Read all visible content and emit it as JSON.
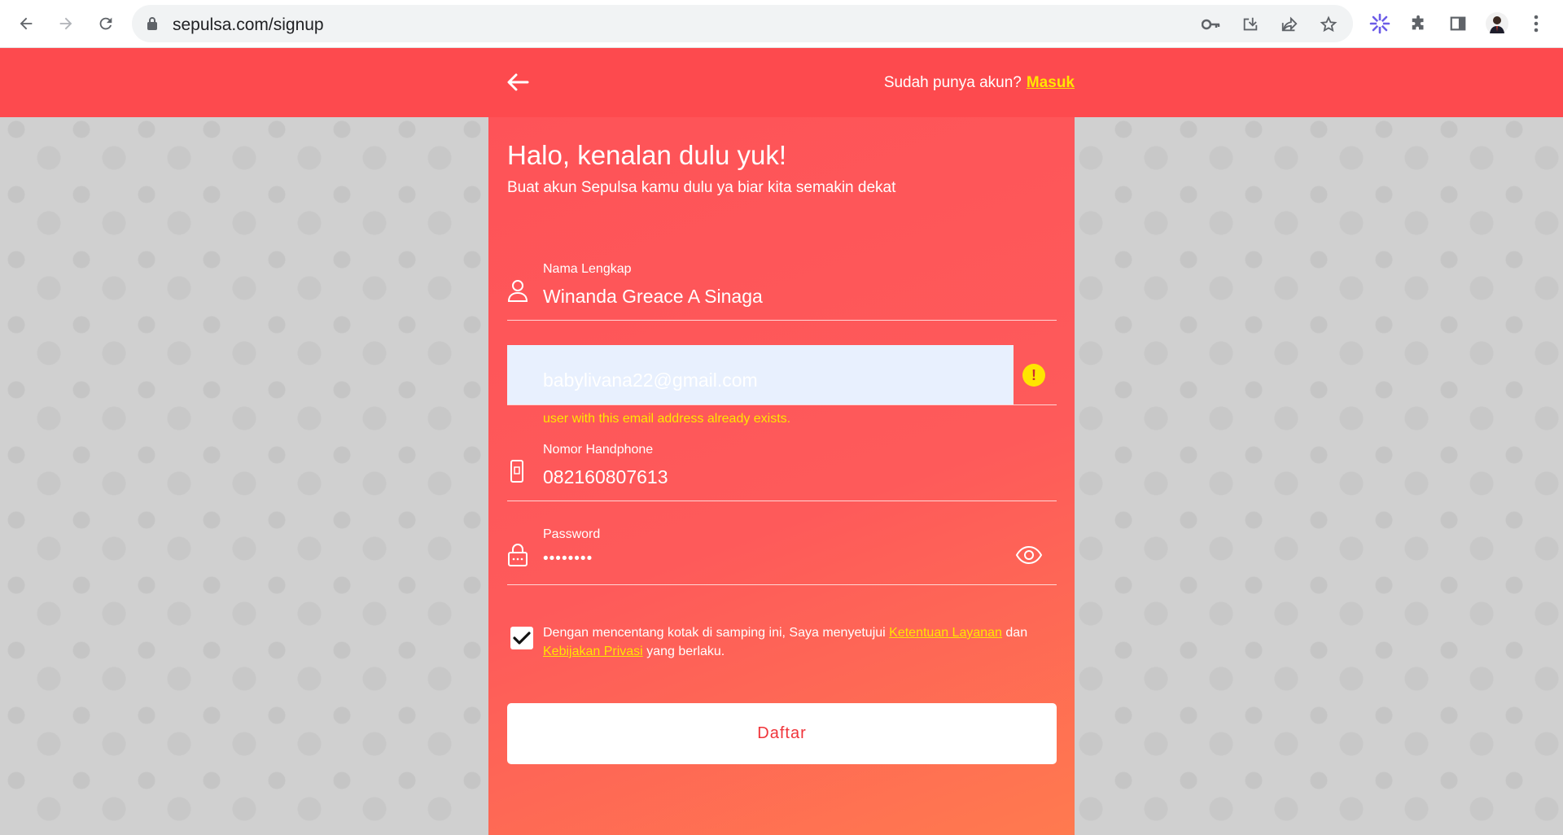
{
  "browser": {
    "url": "sepulsa.com/signup",
    "icons": [
      "back-icon",
      "forward-icon",
      "reload-icon",
      "lock-icon",
      "key-icon",
      "install-icon",
      "share-icon",
      "star-icon",
      "extension-flower-icon",
      "puzzle-icon",
      "sidepanel-icon",
      "profile-avatar",
      "menu-dots-icon"
    ]
  },
  "header": {
    "have_account_text": "Sudah punya akun?",
    "login_link": "Masuk"
  },
  "form": {
    "title": "Halo, kenalan dulu yuk!",
    "subtitle": "Buat akun Sepulsa kamu dulu ya biar kita semakin dekat",
    "name": {
      "label": "Nama Lengkap",
      "value": "Winanda Greace A Sinaga"
    },
    "email": {
      "value": "babylivana22@gmail.com",
      "error": "user with this email address already exists."
    },
    "phone": {
      "label": "Nomor Handphone",
      "value": "082160807613"
    },
    "password": {
      "label": "Password",
      "value": "••••••••"
    },
    "terms": {
      "prefix": "Dengan mencentang kotak di samping ini, Saya menyetujui",
      "tos_link": "Ketentuan Layanan",
      "and": "dan",
      "privacy_link": "Kebijakan Privasi",
      "suffix": "yang berlaku.",
      "checked": true
    },
    "submit_label": "Daftar"
  },
  "colors": {
    "brand_red": "#fd4a4e",
    "accent_yellow": "#ffe600",
    "autofill_bg": "#e8f0fe"
  }
}
